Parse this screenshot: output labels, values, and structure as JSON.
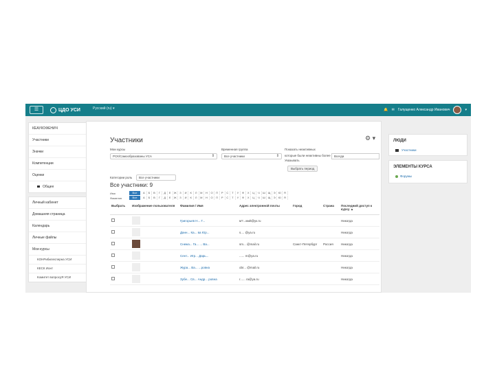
{
  "navbar": {
    "brand": "ЦДО УСИ",
    "menu": "Русский (ru) ▾",
    "user_name": "Галущенко Александр Иванович",
    "bell": "🔔",
    "msg": "✉",
    "caret": "▾",
    "toggle": "☰"
  },
  "drawer": {
    "group1": [
      "КЕАУКОФЕНИЧ",
      "Участники",
      "Значки",
      "Компетенции",
      "Оценки"
    ],
    "folder_item": "Общее",
    "group2": [
      "Личный кабинет",
      "Домашняя страница",
      "Календарь",
      "Личные файлы",
      "Мои курсы"
    ],
    "courses": [
      "КОНРибилесперна УСИ",
      "КЕСК Ионт",
      "Комитет вопросуЯ УСИ"
    ]
  },
  "main": {
    "title": "Участники",
    "gear": "⚙ ▾",
    "filter": {
      "course_label": "Мои курсы",
      "course_value": "РСК/Самообразованы УСА",
      "role_label": "Временная группа",
      "role_value": "Все участники",
      "inactive_label": "Показать неактивных",
      "inactive_value": "которые были неактивны более",
      "inactive_sub": "Указывать",
      "period_value": "Всегда",
      "apply_button": "Выбрать период",
      "category_label": "Категории роль",
      "category_value": "Все участники"
    },
    "all_title": "Все участники: 9",
    "firstname_label": "Имя",
    "lastname_label": "Фамилия",
    "all_btn": "Все",
    "letters": [
      "А",
      "Б",
      "В",
      "Г",
      "Д",
      "Е",
      "Ж",
      "З",
      "И",
      "К",
      "Л",
      "М",
      "Н",
      "О",
      "П",
      "Р",
      "С",
      "Т",
      "У",
      "Ф",
      "Х",
      "Ц",
      "Ч",
      "Ш",
      "Щ",
      "Э",
      "Ю",
      "Я"
    ],
    "columns": [
      "Выбрать",
      "Изображение пользователя",
      "Фамилия / Имя",
      "Адрес электронной почты",
      "Город",
      "Страна",
      "Последний доступ к курсу ▲"
    ],
    "rows": [
      {
        "name": "Григорьев Н... Г...",
        "email": "м?...мий@ук.ru",
        "city": "",
        "country": "",
        "access": "Никогда",
        "photo": false
      },
      {
        "name": "Данн... Ка... ва Юр...",
        "email": "s.... @ya.ru",
        "city": "",
        "country": "",
        "access": "Никогда",
        "photo": false
      },
      {
        "name": "Снежа... Га... ... Ва...",
        "email": "sm... @mail.ru",
        "city": "Санкт-Петербург",
        "country": "Россия",
        "access": "Никогда",
        "photo": true
      },
      {
        "name": "Сент... Игр... Дарь...",
        "email": "...... m@ya.ru",
        "city": "",
        "country": "",
        "access": "Никогда",
        "photo": false
      },
      {
        "name": "Жура... Ва... ...ровна",
        "email": "obr... @mail.ru",
        "city": "",
        "country": "",
        "access": "Никогда",
        "photo": false
      },
      {
        "name": "Зубе... Св... Андр... ровна",
        "email": "r...... ra@ya.ru",
        "city": "",
        "country": "",
        "access": "Никогда",
        "photo": false
      }
    ]
  },
  "right": {
    "people_title": "ЛЮДИ",
    "people_link": "Участники",
    "course_title": "ЭЛЕМЕНТЫ КУРСА",
    "course_link": "Форумы"
  }
}
